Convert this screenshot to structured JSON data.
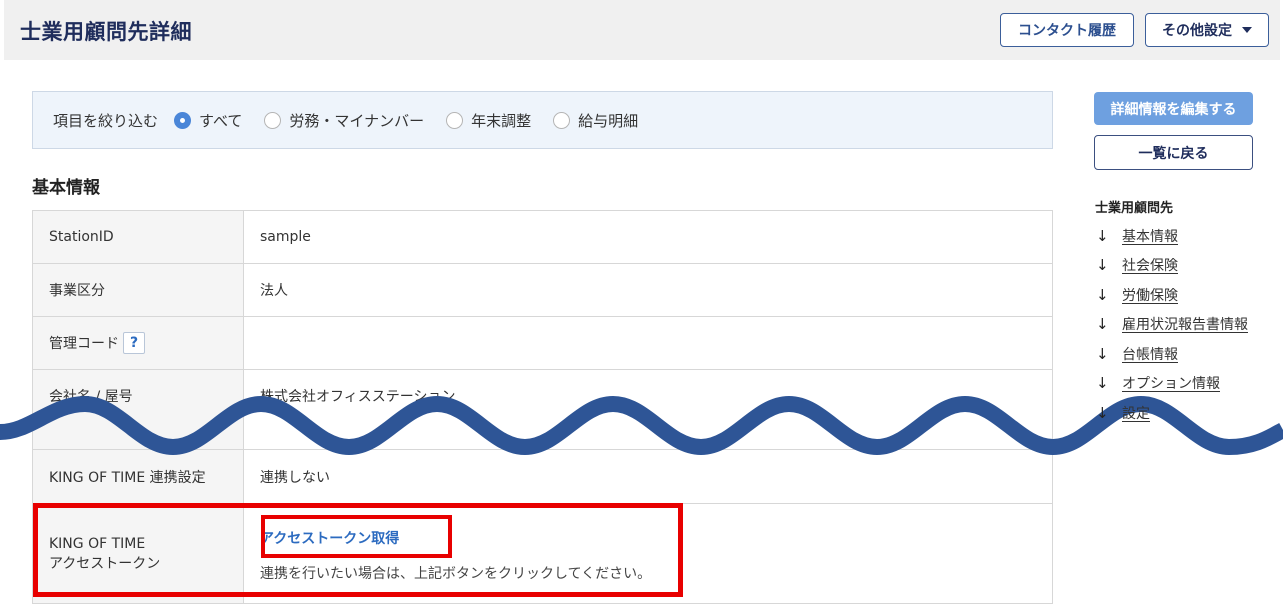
{
  "header": {
    "title": "士業用顧問先詳細",
    "contact_history_label": "コンタクト履歴",
    "other_settings_label": "その他設定"
  },
  "filter": {
    "label": "項目を絞り込む",
    "options": [
      {
        "label": "すべて",
        "checked": true
      },
      {
        "label": "労務・マイナンバー",
        "checked": false
      },
      {
        "label": "年末調整",
        "checked": false
      },
      {
        "label": "給与明細",
        "checked": false
      }
    ]
  },
  "basic_info": {
    "section_title": "基本情報",
    "rows": [
      {
        "label": "StationID",
        "value": "sample"
      },
      {
        "label": "事業区分",
        "value": "法人"
      },
      {
        "label": "管理コード",
        "value": "",
        "help_icon": "?"
      },
      {
        "label": "会社名 / 屋号",
        "value": "株式会社オフィスステーション"
      },
      {
        "label": "KING OF TIME 連携設定",
        "value": "連携しない"
      }
    ],
    "token_row": {
      "label_line1": "KING OF TIME",
      "label_line2": "アクセストークン",
      "link_label": "アクセストークン取得",
      "note": "連携を行いたい場合は、上記ボタンをクリックしてください。"
    }
  },
  "side": {
    "edit_button_label": "詳細情報を編集する",
    "back_button_label": "一覧に戻る",
    "toc_title": "士業用顧問先",
    "toc_items": [
      {
        "label": "基本情報",
        "icon": "arrow-down-icon"
      },
      {
        "label": "社会保険",
        "icon": "arrow-down-icon"
      },
      {
        "label": "労働保険",
        "icon": "arrow-down-icon"
      },
      {
        "label": "雇用状況報告書情報",
        "icon": "arrow-down-icon"
      },
      {
        "label": "台帳情報",
        "icon": "arrow-down-icon"
      },
      {
        "label": "オプション情報",
        "icon": "arrow-down-icon"
      },
      {
        "label": "設定",
        "icon": "arrow-down-icon"
      }
    ]
  },
  "colors": {
    "wave": "#2e5596",
    "highlight": "#e80000",
    "accent": "#4a86d8"
  }
}
